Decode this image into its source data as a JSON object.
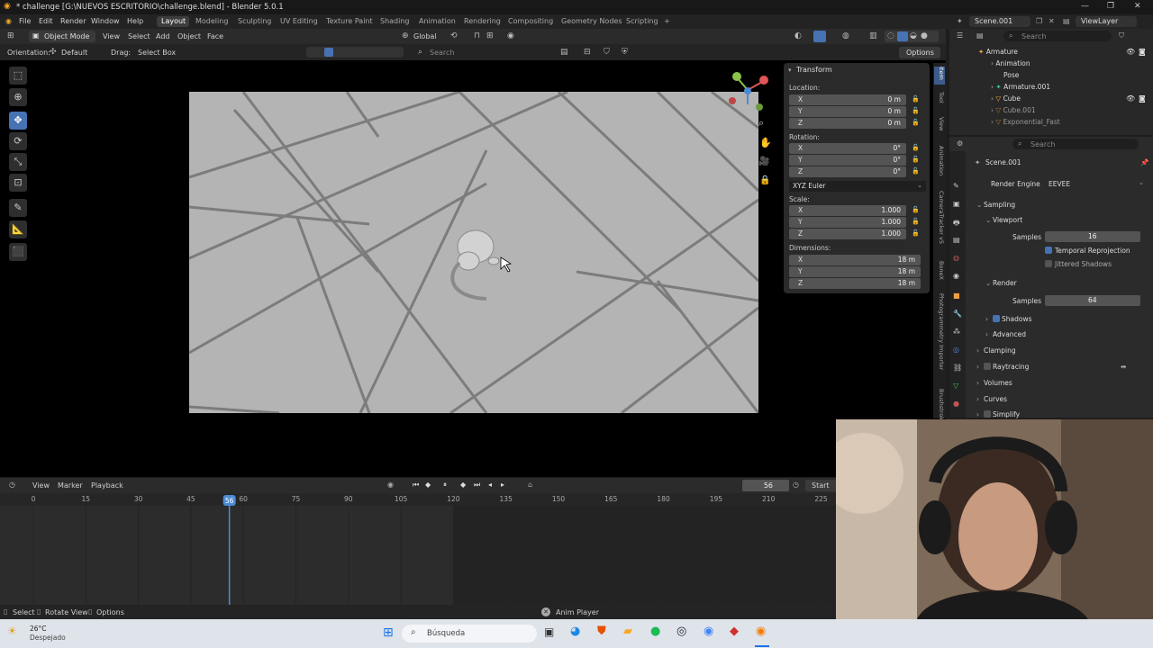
{
  "title_bar": {
    "title": "* challenge [G:\\NUEVOS ESCRITORIO\\challenge.blend] - Blender 5.0.1"
  },
  "menu": {
    "items": [
      "File",
      "Edit",
      "Render",
      "Window",
      "Help"
    ],
    "workspaces": [
      "Layout",
      "Modeling",
      "Sculpting",
      "UV Editing",
      "Texture Paint",
      "Shading",
      "Animation",
      "Rendering",
      "Compositing",
      "Geometry Nodes",
      "Scripting"
    ],
    "active_workspace": "Layout",
    "add_tab": "+",
    "scene": "Scene.001",
    "view_layer": "ViewLayer"
  },
  "viewport_header": {
    "mode": "Object Mode",
    "menus": [
      "View",
      "Select",
      "Add",
      "Object",
      "Face"
    ],
    "transform_space": "Global",
    "orientation_label": "Orientation:",
    "orientation_value": "Default",
    "drag_label": "Drag:",
    "drag_value": "Select Box",
    "search_placeholder": "Search",
    "options": "Options"
  },
  "transform_panel": {
    "title": "Transform",
    "location_label": "Location:",
    "location": [
      {
        "axis": "X",
        "value": "0 m"
      },
      {
        "axis": "Y",
        "value": "0 m"
      },
      {
        "axis": "Z",
        "value": "0 m"
      }
    ],
    "rotation_label": "Rotation:",
    "rotation": [
      {
        "axis": "X",
        "value": "0°"
      },
      {
        "axis": "Y",
        "value": "0°"
      },
      {
        "axis": "Z",
        "value": "0°"
      }
    ],
    "rotation_mode": "XYZ Euler",
    "scale_label": "Scale:",
    "scale": [
      {
        "axis": "X",
        "value": "1.000"
      },
      {
        "axis": "Y",
        "value": "1.000"
      },
      {
        "axis": "Z",
        "value": "1.000"
      }
    ],
    "dimensions_label": "Dimensions:",
    "dimensions": [
      {
        "axis": "X",
        "value": "18 m"
      },
      {
        "axis": "Y",
        "value": "18 m"
      },
      {
        "axis": "Z",
        "value": "18 m"
      }
    ]
  },
  "sidebar_tabs": [
    "Item",
    "Tool",
    "View",
    "Animation",
    "CameraTracker v5",
    "BoneX",
    "Photogrammetry Importer",
    "Brushstrokes"
  ],
  "outliner": {
    "search_placeholder": "Search",
    "items": [
      "Armature",
      "Animation",
      "Pose",
      "Armature.001",
      "Cube",
      "Cube.001",
      "Exponential_Fast"
    ]
  },
  "properties": {
    "search_placeholder": "Search",
    "scene": "Scene.001",
    "render_engine_label": "Render Engine",
    "render_engine": "EEVEE",
    "sampling": "Sampling",
    "viewport": "Viewport",
    "samples_label": "Samples",
    "viewport_samples": "16",
    "temporal_reprojection": "Temporal Reprojection",
    "jittered_shadows": "Jittered Shadows",
    "render": "Render",
    "render_samples": "64",
    "shadows": "Shadows",
    "advanced": "Advanced",
    "sections": [
      "Clamping",
      "Raytracing",
      "Volumes",
      "Curves",
      "Simplify"
    ]
  },
  "timeline": {
    "menus": [
      "View",
      "Marker"
    ],
    "playback": "Playback",
    "current_frame": "56",
    "start_label": "Start",
    "ruler": [
      "0",
      "15",
      "30",
      "45",
      "60",
      "75",
      "90",
      "105",
      "120",
      "135",
      "150",
      "165",
      "180",
      "195",
      "210",
      "225"
    ],
    "scene_end_frame": 120
  },
  "statusbar": {
    "select": "Select",
    "rotate_view": "Rotate View",
    "options": "Options",
    "task_label": "Anim Player"
  },
  "taskbar": {
    "temperature": "26°C",
    "weather": "Despejado",
    "search_placeholder": "Búsqueda"
  },
  "colors": {
    "accent": "#4772b3",
    "playhead": "#4b8bd4",
    "active_tab": "#3d5a8a"
  }
}
